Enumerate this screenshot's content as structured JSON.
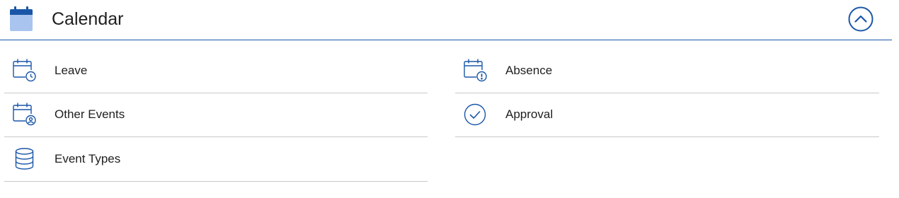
{
  "header": {
    "title": "Calendar",
    "icon": "calendar-icon",
    "collapse_icon": "chevron-up-icon"
  },
  "colors": {
    "accent": "#1a56a8",
    "icon_fill": "#a9c4ee",
    "divider": "#c8c8c8"
  },
  "items": [
    {
      "label": "Leave",
      "icon": "calendar-clock-icon"
    },
    {
      "label": "Absence",
      "icon": "calendar-alert-icon"
    },
    {
      "label": "Other Events",
      "icon": "calendar-user-icon"
    },
    {
      "label": "Approval",
      "icon": "check-circle-icon"
    },
    {
      "label": "Event Types",
      "icon": "database-icon"
    }
  ]
}
